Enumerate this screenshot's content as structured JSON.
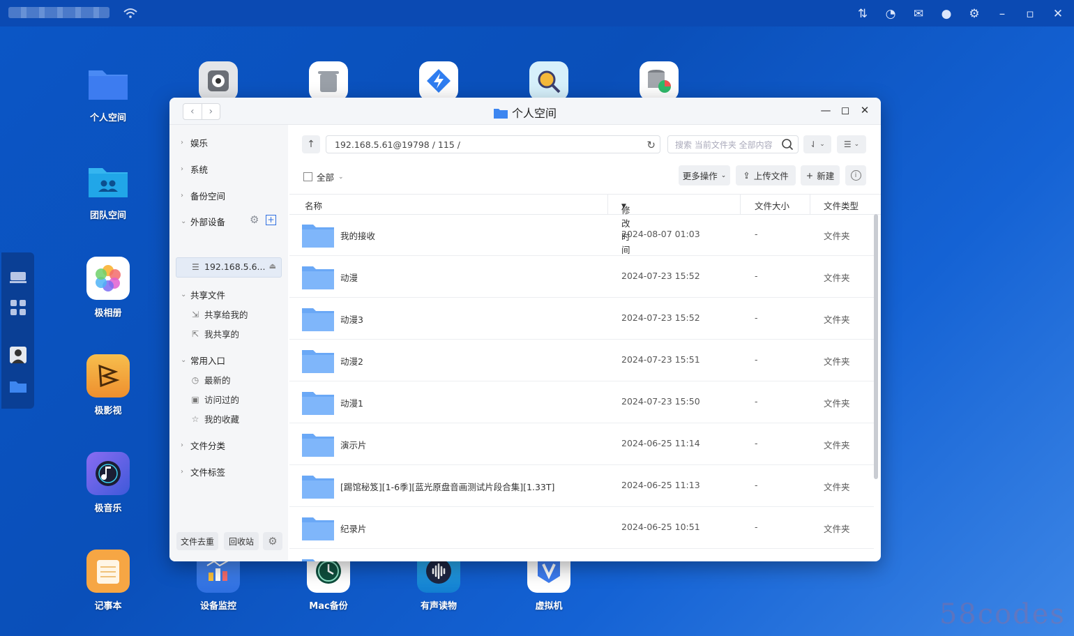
{
  "desktop": {
    "icons": [
      {
        "name": "desk-icon-personal",
        "label": "个人空间",
        "icon": "folder-icon",
        "color": "#3d7cf0"
      },
      {
        "name": "desk-icon-team",
        "label": "团队空间",
        "icon": "team-folder-icon",
        "color": "#21a6e8"
      },
      {
        "name": "desk-icon-photos",
        "label": "极相册",
        "icon": "photos-icon",
        "color": "#ffffff"
      },
      {
        "name": "desk-icon-video",
        "label": "极影视",
        "icon": "video-icon",
        "color": "#f2a33a"
      },
      {
        "name": "desk-icon-music",
        "label": "极音乐",
        "icon": "music-icon",
        "color": "#5a5fe0"
      },
      {
        "name": "desk-icon-notes",
        "label": "记事本",
        "icon": "notes-icon",
        "color": "#f6a644"
      },
      {
        "name": "desk-icon-monitor",
        "label": "设备监控",
        "icon": "monitor-icon",
        "color": "#3d7cf0"
      },
      {
        "name": "desk-icon-macbackup",
        "label": "Mac备份",
        "icon": "timemachine-icon",
        "color": "#ffffff"
      },
      {
        "name": "desk-icon-audiobook",
        "label": "有声读物",
        "icon": "audiobook-icon",
        "color": "#1fa0e0"
      },
      {
        "name": "desk-icon-vm",
        "label": "虚拟机",
        "icon": "vm-icon",
        "color": "#ffffff"
      }
    ]
  },
  "window": {
    "title": "个人空间",
    "sidebar": {
      "groups": [
        "娱乐",
        "系统",
        "备份空间",
        "外部设备",
        "共享文件",
        "常用入口",
        "文件分类",
        "文件标签"
      ],
      "external_device": "192.168.5.6...",
      "shared": [
        "共享给我的",
        "我共享的"
      ],
      "common": [
        "最新的",
        "访问过的",
        "我的收藏"
      ],
      "footer": {
        "dedupe": "文件去重",
        "recycle": "回收站"
      }
    },
    "toolbar": {
      "path": "192.168.5.61@19798 / 115 /",
      "search_placeholder": "搜索 当前文件夹 全部内容",
      "select_all": "全部",
      "more_ops": "更多操作",
      "upload": "上传文件",
      "new": "新建"
    },
    "columns": {
      "name": "名称",
      "modified": "修改时间",
      "size": "文件大小",
      "type": "文件类型"
    },
    "files": [
      {
        "name": "我的接收",
        "modified": "2024-08-07 01:03",
        "size": "-",
        "type": "文件夹"
      },
      {
        "name": "动漫",
        "modified": "2024-07-23 15:52",
        "size": "-",
        "type": "文件夹"
      },
      {
        "name": "动漫3",
        "modified": "2024-07-23 15:52",
        "size": "-",
        "type": "文件夹"
      },
      {
        "name": "动漫2",
        "modified": "2024-07-23 15:51",
        "size": "-",
        "type": "文件夹"
      },
      {
        "name": "动漫1",
        "modified": "2024-07-23 15:50",
        "size": "-",
        "type": "文件夹"
      },
      {
        "name": "演示片",
        "modified": "2024-06-25 11:14",
        "size": "-",
        "type": "文件夹"
      },
      {
        "name": "[踢馆秘笈][1-6季][蓝光原盘音画测试片段合集][1.33T]",
        "modified": "2024-06-25 11:13",
        "size": "-",
        "type": "文件夹"
      },
      {
        "name": "纪录片",
        "modified": "2024-06-25 10:51",
        "size": "-",
        "type": "文件夹"
      },
      {
        "name": "",
        "modified": "",
        "size": "",
        "type": ""
      }
    ]
  },
  "watermark": "58codes"
}
